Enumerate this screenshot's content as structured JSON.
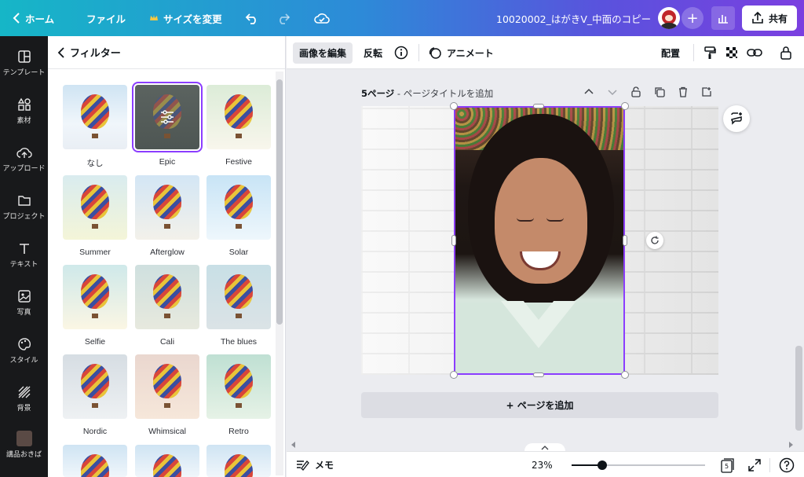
{
  "topbar": {
    "home": "ホーム",
    "file": "ファイル",
    "resize": "サイズを変更",
    "doc_title": "10020002_はがきV_中面のコピー",
    "share": "共有"
  },
  "sidebar": {
    "items": [
      {
        "label": "テンプレート",
        "icon": "template-icon"
      },
      {
        "label": "素材",
        "icon": "elements-icon"
      },
      {
        "label": "アップロード",
        "icon": "upload-icon"
      },
      {
        "label": "プロジェクト",
        "icon": "folder-icon"
      },
      {
        "label": "テキスト",
        "icon": "text-icon"
      },
      {
        "label": "写真",
        "icon": "photo-icon"
      },
      {
        "label": "スタイル",
        "icon": "palette-icon"
      },
      {
        "label": "背景",
        "icon": "background-icon"
      },
      {
        "label": "講品おきば",
        "icon": "custom-app-icon"
      }
    ]
  },
  "panel": {
    "title": "フィルター",
    "filters": [
      {
        "name": "なし",
        "tint": "none"
      },
      {
        "name": "Epic",
        "tint": "dark",
        "selected": true
      },
      {
        "name": "Festive",
        "tint": "warm"
      },
      {
        "name": "Summer",
        "tint": "yellow"
      },
      {
        "name": "Afterglow",
        "tint": "soft"
      },
      {
        "name": "Solar",
        "tint": "bright"
      },
      {
        "name": "Selfie",
        "tint": "pastel"
      },
      {
        "name": "Cali",
        "tint": "muted"
      },
      {
        "name": "The blues",
        "tint": "cool"
      },
      {
        "name": "Nordic",
        "tint": "desat"
      },
      {
        "name": "Whimsical",
        "tint": "pink"
      },
      {
        "name": "Retro",
        "tint": "teal"
      }
    ]
  },
  "editor_toolbar": {
    "edit_image": "画像を編集",
    "flip": "反転",
    "animate": "アニメート",
    "position": "配置"
  },
  "canvas": {
    "page_number": "5ページ",
    "page_title_placeholder": " - ページタイトルを追加",
    "add_page": "+ ページを追加"
  },
  "bottombar": {
    "notes": "メモ",
    "zoom": "23%",
    "zoom_level": 0.23,
    "page_count": "5"
  },
  "colors": {
    "accent": "#8b3dff",
    "topbar_start": "#16b6c7",
    "topbar_end": "#7b3fe0",
    "sidebar_bg": "#18191b"
  }
}
